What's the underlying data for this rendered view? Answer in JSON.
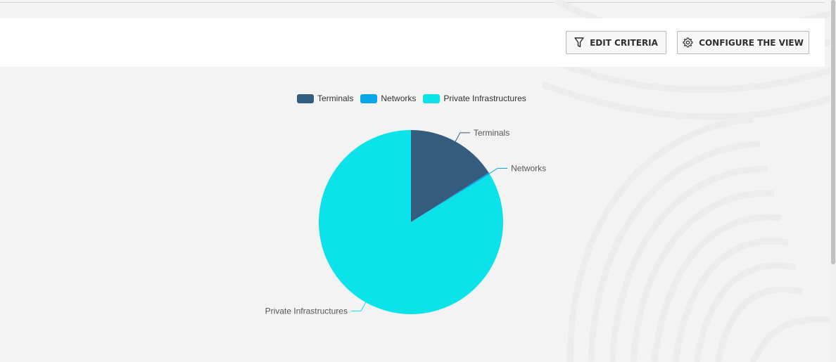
{
  "toolbar": {
    "edit_criteria_label": "EDIT CRITERIA",
    "edit_criteria_icon": "filter-icon",
    "configure_view_label": "CONFIGURE THE VIEW",
    "configure_view_icon": "gear-icon"
  },
  "chart_data": {
    "type": "pie",
    "legend_placement": "top",
    "categories": [
      "Terminals",
      "Networks",
      "Private Infrastructures"
    ],
    "values": [
      16,
      0.3,
      83.7
    ],
    "colors": [
      "#345c7c",
      "#0aa7e8",
      "#0be2ea"
    ]
  }
}
